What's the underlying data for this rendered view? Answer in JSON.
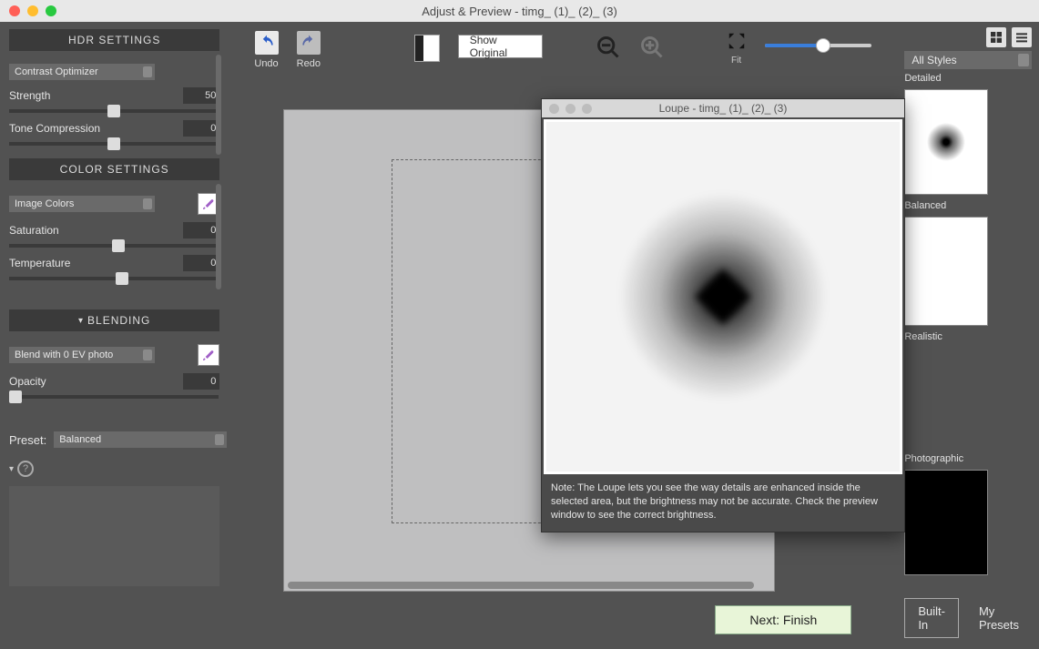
{
  "window": {
    "title": "Adjust & Preview - timg_ (1)_ (2)_ (3)"
  },
  "left": {
    "hdr_settings": {
      "title": "HDR SETTINGS",
      "method": "Contrast Optimizer",
      "strength": {
        "label": "Strength",
        "value": "50",
        "pos": 50
      },
      "tone": {
        "label": "Tone Compression",
        "value": "0",
        "pos": 50
      }
    },
    "color_settings": {
      "title": "COLOR SETTINGS",
      "mode": "Image Colors",
      "saturation": {
        "label": "Saturation",
        "value": "0",
        "pos": 52
      },
      "temperature": {
        "label": "Temperature",
        "value": "0",
        "pos": 54
      }
    },
    "blending": {
      "title": "BLENDING",
      "blend_with": "Blend with  0 EV photo",
      "opacity": {
        "label": "Opacity",
        "value": "0",
        "pos": 3
      }
    },
    "preset": {
      "label": "Preset:",
      "value": "Balanced"
    }
  },
  "toolbar": {
    "undo": "Undo",
    "redo": "Redo",
    "show_original": "Show Original",
    "fit": "Fit"
  },
  "loupe": {
    "title": "Loupe - timg_ (1)_ (2)_ (3)",
    "note": "Note: The Loupe lets you see the way details are enhanced inside the selected area, but the brightness may not be accurate. Check the preview window to see the correct brightness."
  },
  "right": {
    "all_styles": "All Styles",
    "detailed": "Detailed",
    "balanced": "Balanced",
    "realistic": "Realistic",
    "photographic": "Photographic",
    "builtin": "Built-In",
    "my_presets": "My Presets"
  },
  "next": "Next: Finish"
}
